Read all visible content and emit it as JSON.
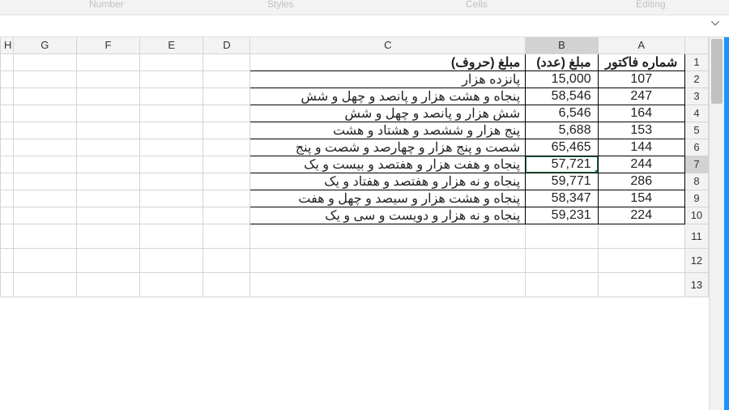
{
  "ribbon": {
    "group_number": "Number",
    "group_styles": "Styles",
    "group_cells": "Cells",
    "group_editing": "Editing"
  },
  "columns": {
    "H": "H",
    "G": "G",
    "F": "F",
    "E": "E",
    "D": "D",
    "C": "C",
    "B": "B",
    "A": "A"
  },
  "headers": {
    "A": "شماره فاکتور",
    "B": "مبلغ (عدد)",
    "C": "مبلغ (حروف)"
  },
  "rows": [
    {
      "n": "2",
      "A": "107",
      "B": "15,000",
      "C": "پانزده هزار"
    },
    {
      "n": "3",
      "A": "247",
      "B": "58,546",
      "C": "پنجاه و هشت هزار و پانصد و چهل و شش"
    },
    {
      "n": "4",
      "A": "164",
      "B": "6,546",
      "C": "شش هزار و پانصد و چهل و شش"
    },
    {
      "n": "5",
      "A": "153",
      "B": "5,688",
      "C": "پنج هزار و ششصد و هشتاد و هشت"
    },
    {
      "n": "6",
      "A": "144",
      "B": "65,465",
      "C": "شصت و پنج هزار و چهارصد و شصت و پنج"
    },
    {
      "n": "7",
      "A": "244",
      "B": "57,721",
      "C": "پنجاه و هفت هزار و هفتصد و بیست و یک"
    },
    {
      "n": "8",
      "A": "286",
      "B": "59,771",
      "C": "پنجاه و نه هزار و هفتصد و هفتاد و یک"
    },
    {
      "n": "9",
      "A": "154",
      "B": "58,347",
      "C": "پنجاه و هشت هزار و سیصد و چهل و هفت"
    },
    {
      "n": "10",
      "A": "224",
      "B": "59,231",
      "C": "پنجاه و نه هزار و دویست و سی و یک"
    }
  ],
  "empty_row_labels": [
    "11",
    "12",
    "13"
  ],
  "active": {
    "col": "B",
    "row": "7"
  }
}
